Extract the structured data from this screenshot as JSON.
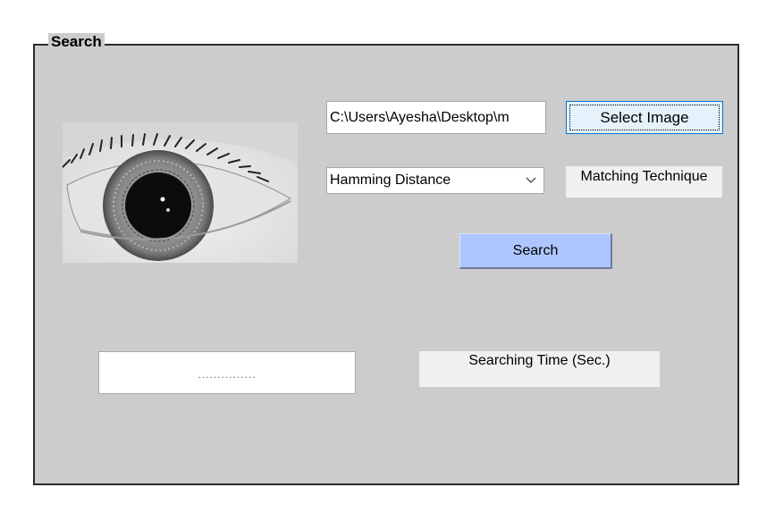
{
  "panel": {
    "title": "Search"
  },
  "image": {
    "icon": "eye-photo"
  },
  "path_field": {
    "value": "C:\\Users\\Ayesha\\Desktop\\m"
  },
  "select_image_button": {
    "label": "Select Image"
  },
  "matching": {
    "selected": "Hamming Distance",
    "label": "Matching Technique"
  },
  "search_button": {
    "label": "Search"
  },
  "result": {
    "value": "..............."
  },
  "time": {
    "label": "Searching Time (Sec.)"
  },
  "colors": {
    "panel_bg": "#cccccc",
    "search_button_bg": "#aec6ff",
    "select_button_bg": "#e5f1fb",
    "label_bg": "#f0f0f0"
  }
}
